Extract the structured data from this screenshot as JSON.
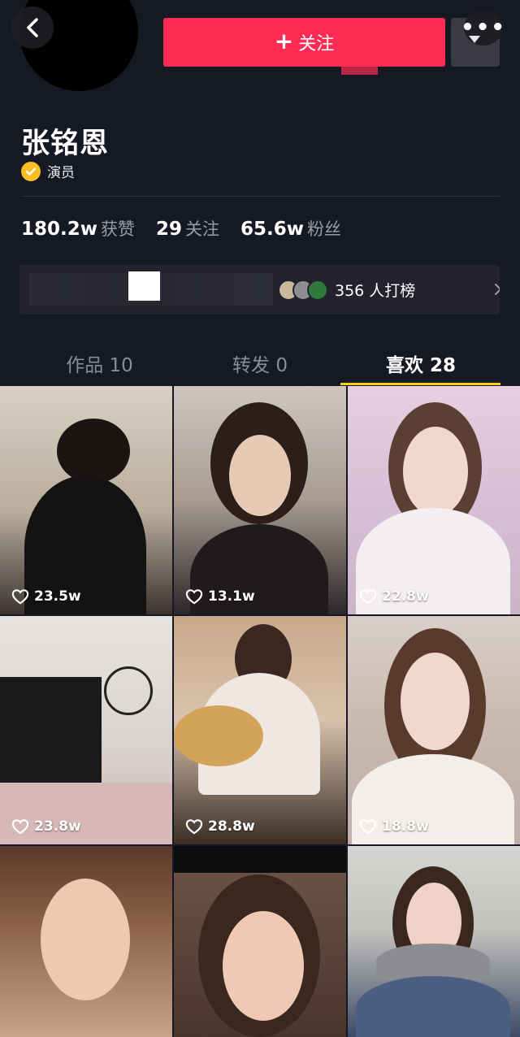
{
  "header": {
    "follow_label": "关注",
    "follow_plus": "+",
    "more_dots": "•••"
  },
  "profile": {
    "name": "张铭恩",
    "verified_label": "演员"
  },
  "stats": [
    {
      "num": "180.2w",
      "label": "获赞"
    },
    {
      "num": "29",
      "label": "关注"
    },
    {
      "num": "65.6w",
      "label": "粉丝"
    }
  ],
  "ranking": {
    "text": "356 人打榜"
  },
  "tabs": [
    {
      "label": "作品 10"
    },
    {
      "label": "转发 0"
    },
    {
      "label": "喜欢 28"
    }
  ],
  "grid": [
    {
      "likes": "23.5w"
    },
    {
      "likes": "13.1w"
    },
    {
      "likes": "22.8w"
    },
    {
      "likes": "23.8w"
    },
    {
      "likes": "28.8w"
    },
    {
      "likes": "18.8w"
    },
    {
      "likes": ""
    },
    {
      "likes": ""
    },
    {
      "likes": ""
    }
  ],
  "colors": {
    "background": "#161823",
    "follow": "#fe2c55",
    "tab_indicator": "#face15",
    "verified": "#fbbf24"
  }
}
